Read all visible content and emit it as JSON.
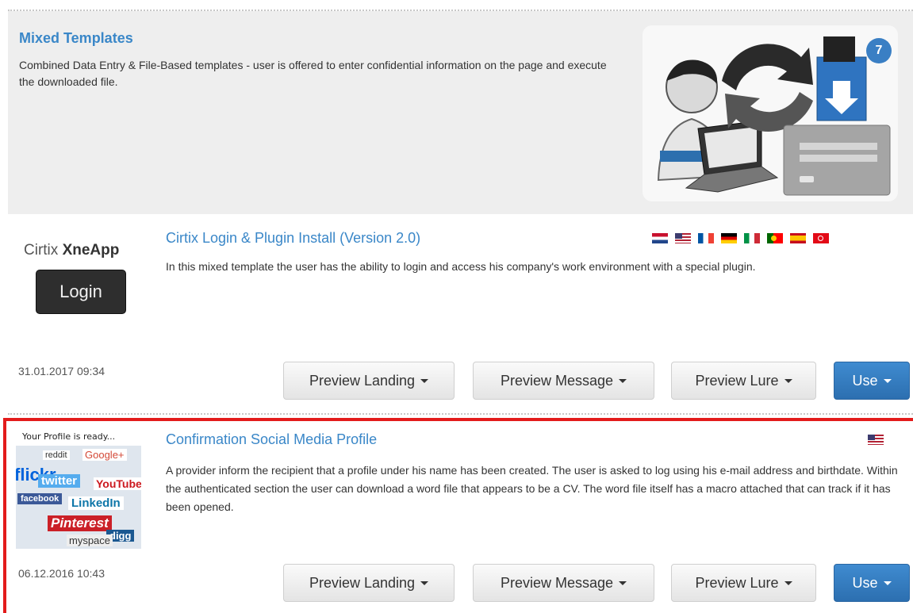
{
  "header": {
    "title": "Mixed Templates",
    "description": "Combined Data Entry & File-Based templates - user is offered to enter confidential information on the page and execute the downloaded file.",
    "badge_count": "7"
  },
  "templates": [
    {
      "title": "Cirtix Login & Plugin Install (Version 2.0)",
      "description": "In this mixed template the user has the ability to login and access his company's work environment with a special plugin.",
      "date": "31.01.2017 09:34",
      "thumbnail": {
        "brand_prefix": "Cirtix ",
        "brand_name": "XneApp",
        "login_label": "Login"
      },
      "languages": [
        "Netherlands",
        "United States",
        "France",
        "Germany",
        "Italy",
        "Portugal",
        "Spain",
        "Turkey"
      ],
      "buttons": {
        "preview_landing": "Preview Landing",
        "preview_message": "Preview Message",
        "preview_lure": "Preview Lure",
        "use": "Use"
      }
    },
    {
      "title": "Confirmation Social Media Profile",
      "description": "A provider inform the recipient that a profile under his name has been created. The user is asked to log using his e-mail address and birthdate. Within the authenticated section the user can download a word file that appears to be a CV. The word file itself has a macro attached that can track if it has been opened.",
      "date": "06.12.2016 10:43",
      "thumbnail": {
        "caption": "Your Profile is ready...",
        "logos": [
          "reddit",
          "Google+",
          "flickr",
          "twitter",
          "YouTube",
          "facebook",
          "LinkedIn",
          "Pinterest",
          "digg",
          "myspace"
        ]
      },
      "languages": [
        "United States"
      ],
      "buttons": {
        "preview_landing": "Preview Landing",
        "preview_message": "Preview Message",
        "preview_lure": "Preview Lure",
        "use": "Use"
      }
    }
  ],
  "colors": {
    "link": "#3a87c8",
    "use_button": "#3577bd",
    "highlight": "#e31b1b",
    "header_bg": "#eeeeee"
  }
}
